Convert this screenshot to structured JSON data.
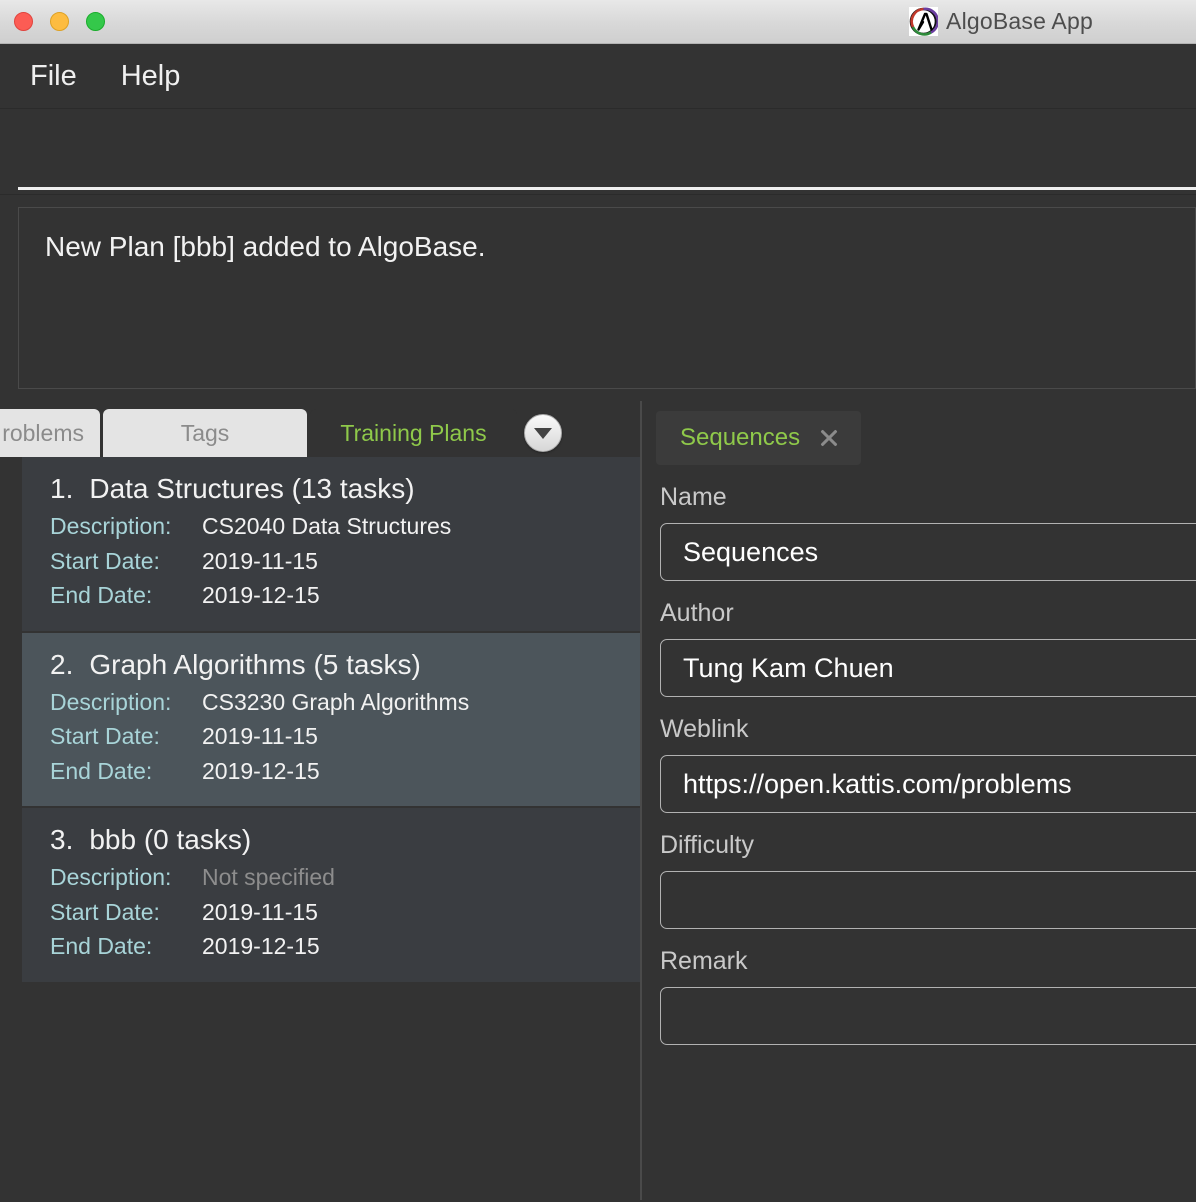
{
  "window": {
    "title": "AlgoBase App",
    "logo_icon": "lambda-logo-icon",
    "traffic_lights": [
      "close-button",
      "minimize-button",
      "maximize-button"
    ]
  },
  "menubar": {
    "items": [
      {
        "label": "File",
        "name": "menu-file"
      },
      {
        "label": "Help",
        "name": "menu-help"
      }
    ]
  },
  "command": {
    "value": "",
    "placeholder": ""
  },
  "result": {
    "text": "New Plan [bbb] added to AlgoBase."
  },
  "left_panel": {
    "tabs": [
      {
        "label": "roblems",
        "active": false,
        "name": "tab-problems"
      },
      {
        "label": "Tags",
        "active": false,
        "name": "tab-tags"
      },
      {
        "label": "Training Plans",
        "active": true,
        "name": "tab-training-plans"
      }
    ],
    "dropdown_icon": "chevron-down-icon",
    "labels": {
      "description": "Description:",
      "start_date": "Start Date:",
      "end_date": "End Date:"
    },
    "plans": [
      {
        "index": "1.",
        "title": "Data Structures (13 tasks)",
        "description": "CS2040 Data Structures",
        "description_unset": false,
        "start_date": "2019-11-15",
        "end_date": "2019-12-15",
        "selected": false
      },
      {
        "index": "2.",
        "title": "Graph Algorithms (5 tasks)",
        "description": "CS3230 Graph Algorithms",
        "description_unset": false,
        "start_date": "2019-11-15",
        "end_date": "2019-12-15",
        "selected": true
      },
      {
        "index": "3.",
        "title": "bbb (0 tasks)",
        "description": "Not specified",
        "description_unset": true,
        "start_date": "2019-11-15",
        "end_date": "2019-12-15",
        "selected": false
      }
    ]
  },
  "right_panel": {
    "tab": {
      "label": "Sequences",
      "close_icon": "close-icon"
    },
    "fields": [
      {
        "label": "Name",
        "value": "Sequences",
        "name": "name-field"
      },
      {
        "label": "Author",
        "value": "Tung Kam Chuen",
        "name": "author-field"
      },
      {
        "label": "Weblink",
        "value": "https://open.kattis.com/problems",
        "name": "weblink-field"
      },
      {
        "label": "Difficulty",
        "value": "",
        "name": "difficulty-field"
      },
      {
        "label": "Remark",
        "value": "",
        "name": "remark-field"
      }
    ]
  },
  "colors": {
    "background": "#333333",
    "accent_green": "#8fc94a",
    "label_cyan": "#a8d4d8",
    "selected_row": "#4c555b",
    "row": "#3a3d41"
  }
}
